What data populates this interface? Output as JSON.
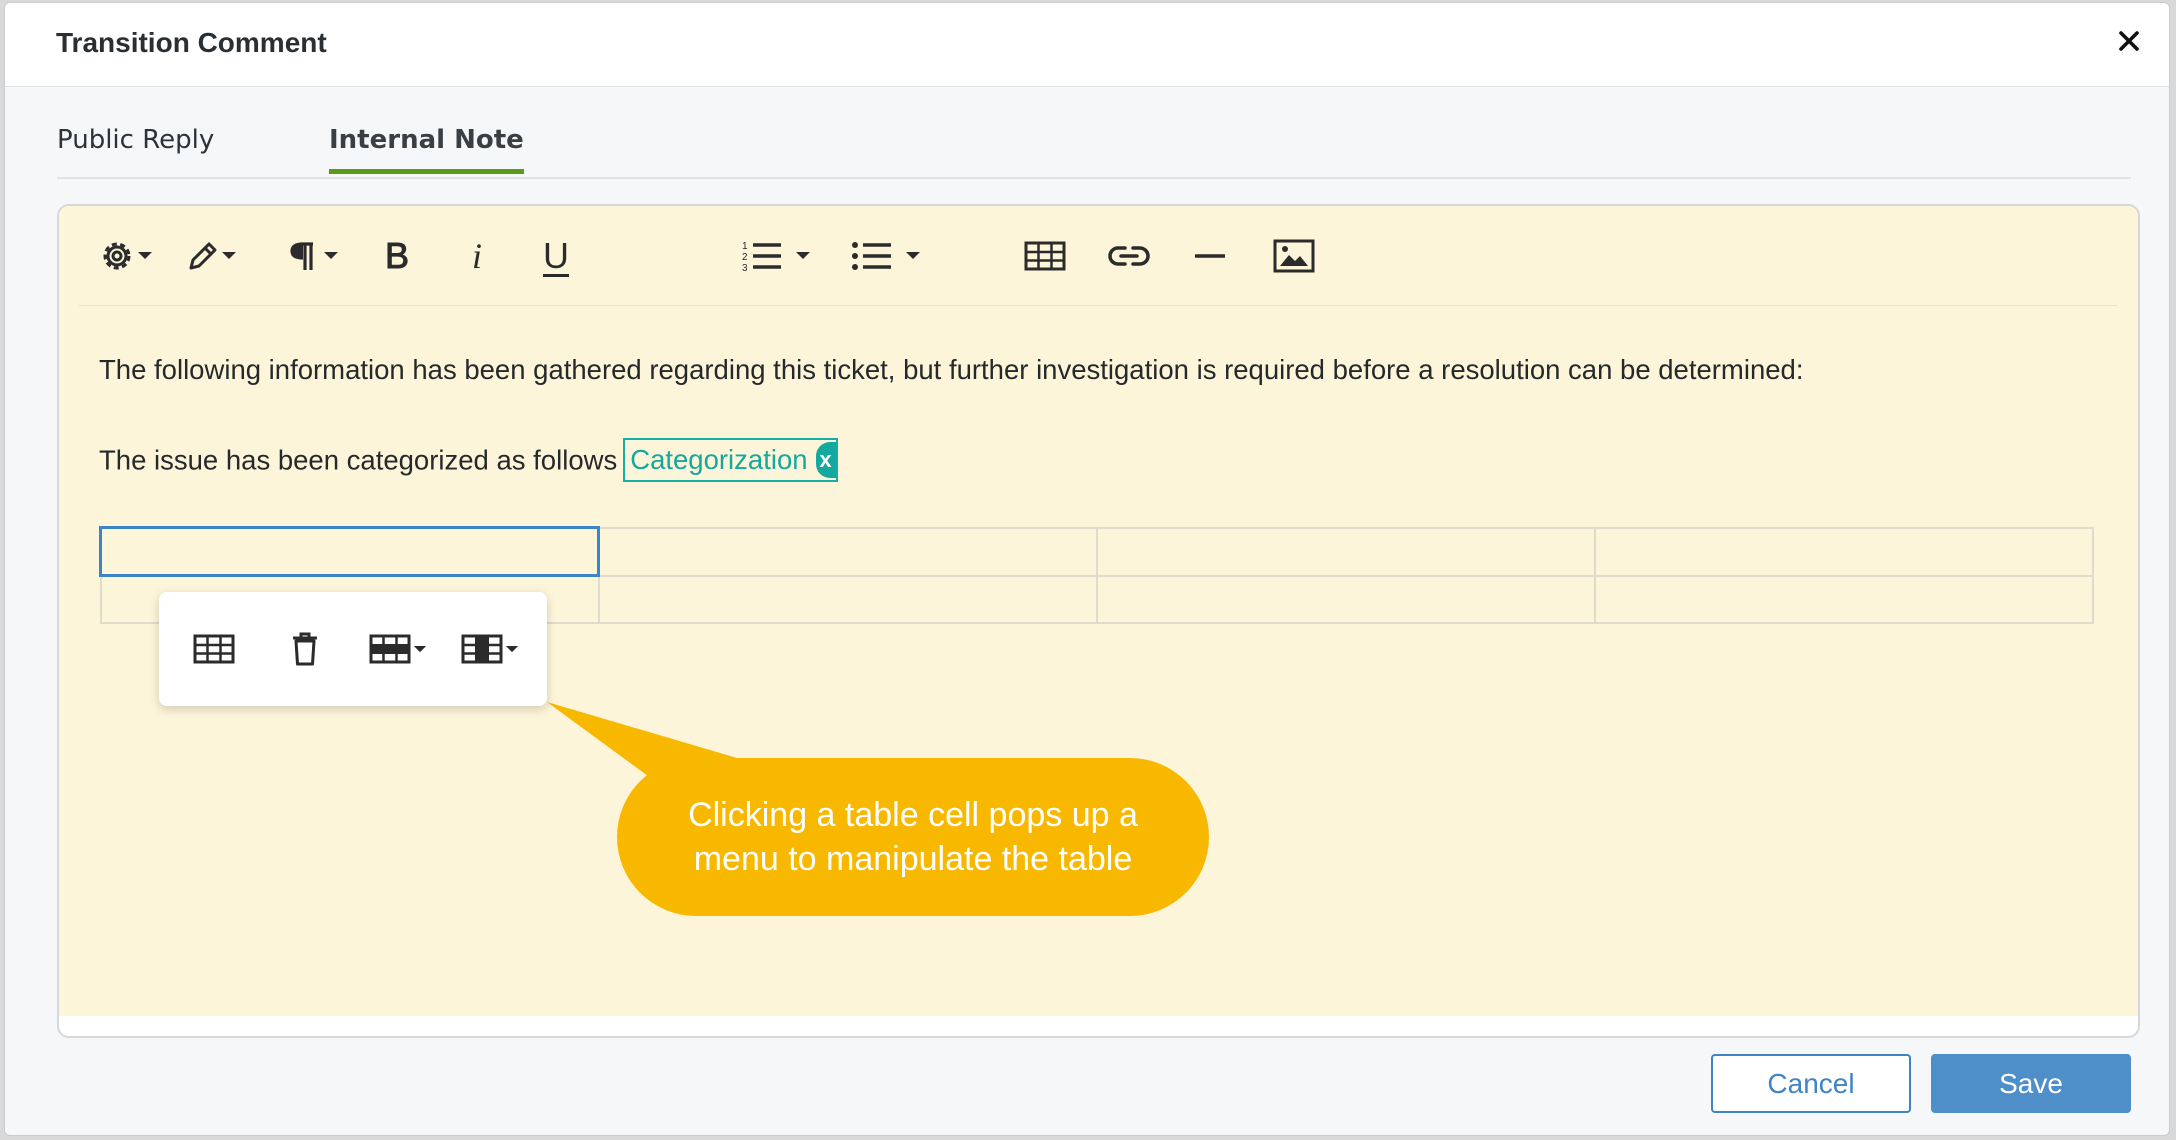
{
  "dialog": {
    "title": "Transition Comment",
    "close_icon": "close-icon"
  },
  "tabs": [
    {
      "label": "Public Reply",
      "active": false
    },
    {
      "label": "Internal Note",
      "active": true
    }
  ],
  "toolbar": {
    "buttons": [
      "settings-icon",
      "pen-icon",
      "paragraph-icon",
      "bold-icon",
      "italic-icon",
      "underline-icon",
      "ordered-list-icon",
      "unordered-list-icon",
      "table-icon",
      "link-icon",
      "horizontal-rule-icon",
      "image-icon"
    ],
    "bold_label": "B",
    "italic_label": "i",
    "underline_label": "U"
  },
  "content": {
    "paragraph1": "The following information has been gathered regarding this ticket, but further investigation is required before a resolution can be determined:",
    "paragraph2": "The issue has been categorized as follows",
    "chip_label": "Categorization",
    "chip_remove": "x",
    "table": {
      "rows": 2,
      "cols": 4,
      "selected_cell": [
        0,
        0
      ]
    }
  },
  "table_popup": {
    "buttons": [
      "table-properties-icon",
      "delete-table-icon",
      "row-options-icon",
      "column-options-icon"
    ]
  },
  "callout": {
    "text": "Clicking a table cell pops up a\nmenu to manipulate the table"
  },
  "footer": {
    "cancel_label": "Cancel",
    "save_label": "Save"
  },
  "colors": {
    "accent_tab": "#5a9a1c",
    "editor_background": "#fdf5d9",
    "chip": "#14a99f",
    "callout": "#f9b800",
    "primary_button": "#4f8fc9"
  }
}
